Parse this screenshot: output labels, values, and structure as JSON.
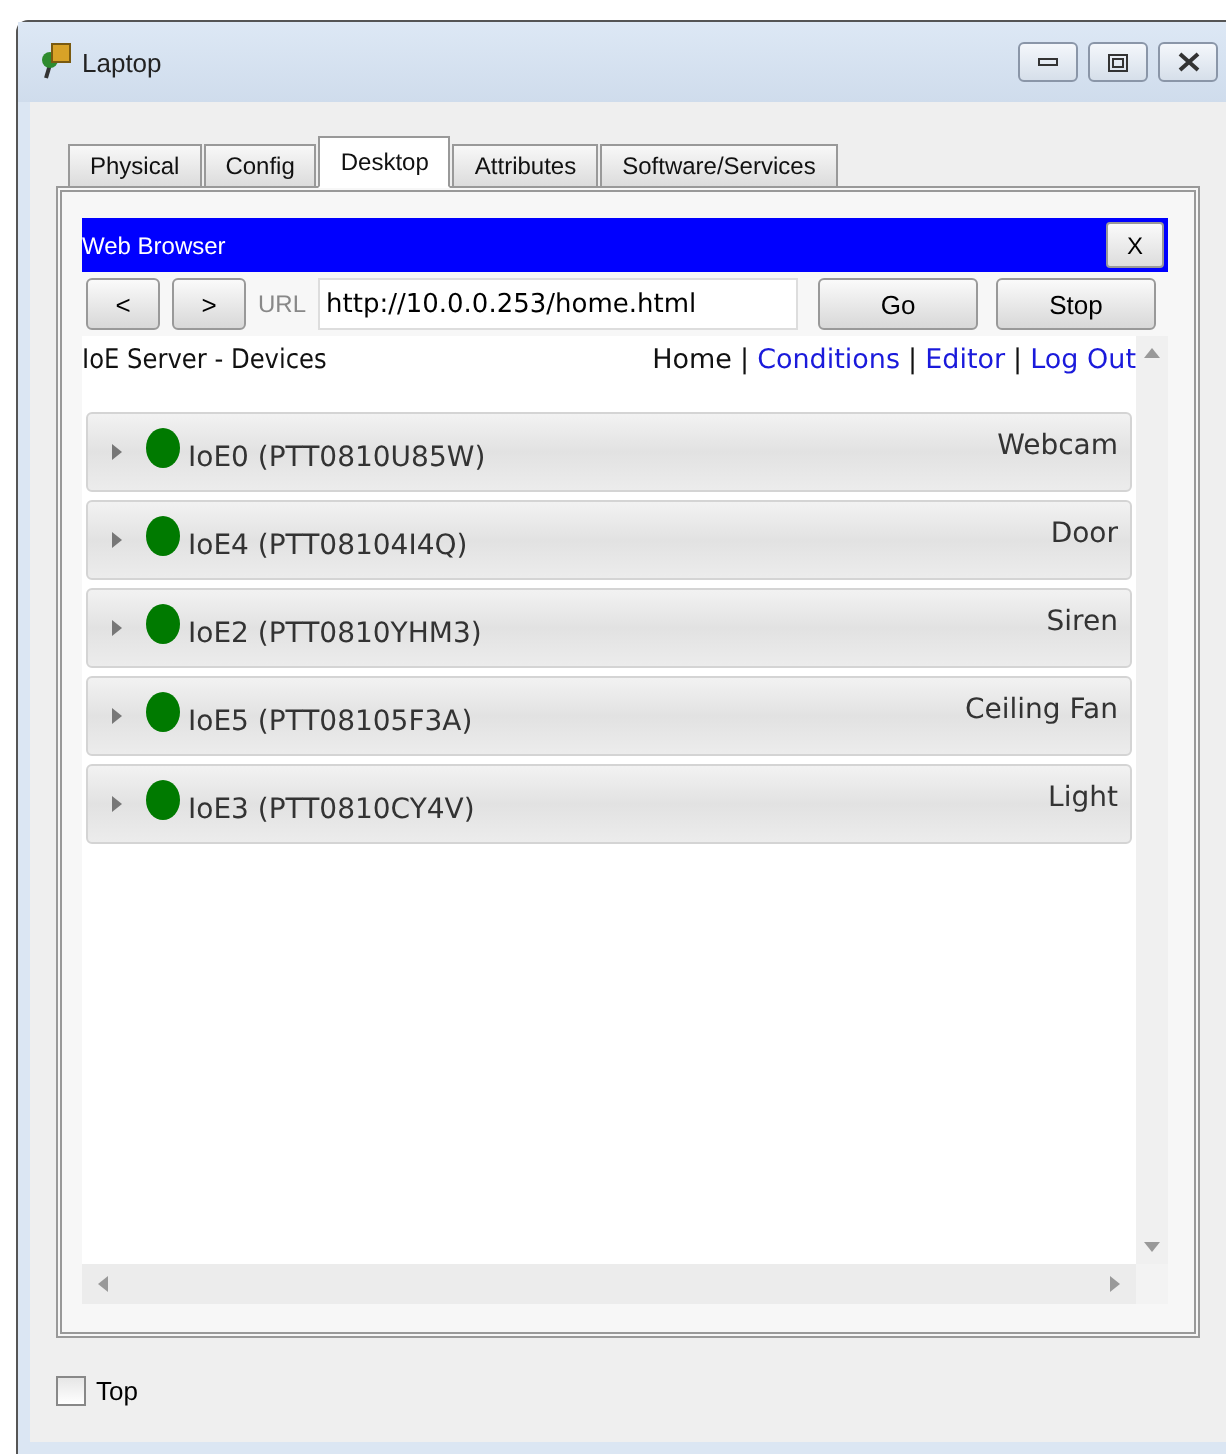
{
  "window": {
    "title": "Laptop"
  },
  "tabs": [
    {
      "label": "Physical",
      "selected": false
    },
    {
      "label": "Config",
      "selected": false
    },
    {
      "label": "Desktop",
      "selected": true
    },
    {
      "label": "Attributes",
      "selected": false
    },
    {
      "label": "Software/Services",
      "selected": false
    }
  ],
  "browser": {
    "title": "Web Browser",
    "close": "X",
    "back": "<",
    "forward": ">",
    "url_label": "URL",
    "url": "http://10.0.0.253/home.html",
    "go": "Go",
    "stop": "Stop"
  },
  "page": {
    "heading": "IoE Server - Devices",
    "nav_separator": "|",
    "nav": [
      {
        "label": "Home",
        "selected": true
      },
      {
        "label": "Conditions",
        "selected": false
      },
      {
        "label": "Editor",
        "selected": false
      },
      {
        "label": "Log Out",
        "selected": false
      }
    ],
    "devices": [
      {
        "name": "IoE0 (PTT0810U85W)",
        "type": "Webcam",
        "color": "#007a00"
      },
      {
        "name": "IoE4 (PTT08104I4Q)",
        "type": "Door",
        "color": "#007a00"
      },
      {
        "name": "IoE2 (PTT0810YHM3)",
        "type": "Siren",
        "color": "#007a00"
      },
      {
        "name": "IoE5 (PTT08105F3A)",
        "type": "Ceiling Fan",
        "color": "#007a00"
      },
      {
        "name": "IoE3 (PTT0810CY4V)",
        "type": "Light",
        "color": "#007a00"
      }
    ]
  },
  "top_checkbox": {
    "label": "Top",
    "checked": false
  }
}
